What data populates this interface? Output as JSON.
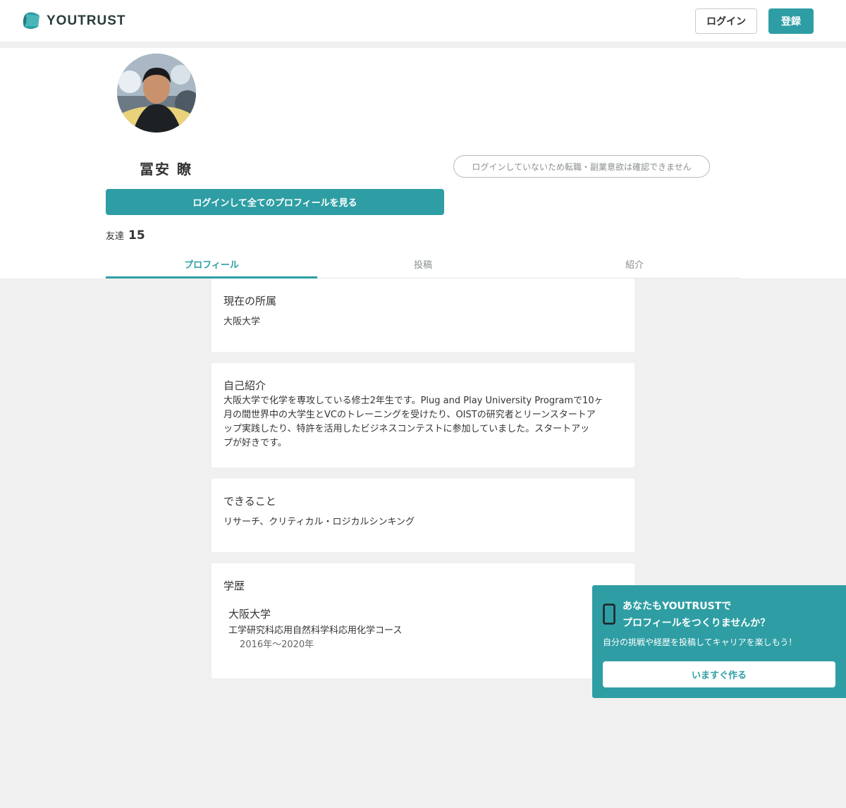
{
  "header": {
    "logo_text": "YOUTRUST",
    "login_label": "ログイン",
    "register_label": "登録"
  },
  "profile": {
    "name": "冨安 瞭",
    "intent_notice": "ログインしていないため転職・副業意欲は確認できません",
    "view_full_profile_label": "ログインして全てのプロフィールを見る",
    "friends_label": "友達",
    "friends_count": "15"
  },
  "tabs": [
    {
      "label": "プロフィール",
      "active": true
    },
    {
      "label": "投稿",
      "active": false
    },
    {
      "label": "紹介",
      "active": false
    }
  ],
  "affiliation": {
    "title": "現在の所属",
    "value": "大阪大学"
  },
  "introduction": {
    "title": "自己紹介",
    "lines": [
      "大阪大学で化学を専攻している修士2年生です。Plug and Play University Programで10ヶ",
      "月の間世界中の大学生とVCのトレーニングを受けたり、OISTの研究者とリーンスタートア",
      "ップ実践したり、特許を活用したビジネスコンテストに参加していました。スタートアッ",
      "プが好きです。"
    ]
  },
  "skills": {
    "title": "できること",
    "value": "リサーチ、クリティカル・ロジカルシンキング"
  },
  "education": {
    "title": "学歴",
    "school": "大阪大学",
    "department": "工学研究科応用自然科学科応用化学コース",
    "period": "2016年〜2020年"
  },
  "promo": {
    "title_line1": "あなたもYOUTRUSTで",
    "title_line2": "プロフィールをつくりませんか？",
    "subtitle": "自分の挑戦や経歴を投稿してキャリアを楽しもう！",
    "button_label": "いますぐ作る"
  },
  "colors": {
    "accent": "#2e9ea4",
    "page_bg": "#eff0ef"
  }
}
